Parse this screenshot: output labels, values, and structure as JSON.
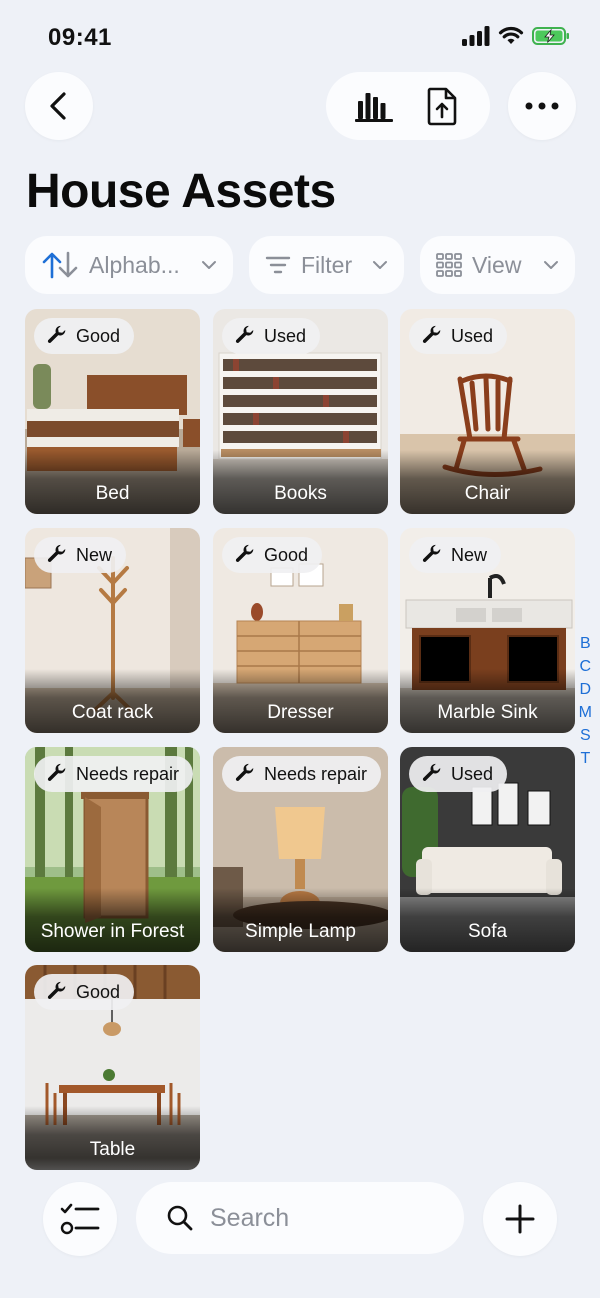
{
  "status_bar": {
    "time": "09:41"
  },
  "page": {
    "title": "House Assets"
  },
  "toolbar": {
    "sort_label": "Alphab...",
    "filter_label": "Filter",
    "view_label": "View"
  },
  "assets": [
    {
      "name": "Bed",
      "condition": "Good"
    },
    {
      "name": "Books",
      "condition": "Used"
    },
    {
      "name": "Chair",
      "condition": "Used"
    },
    {
      "name": "Coat rack",
      "condition": "New"
    },
    {
      "name": "Dresser",
      "condition": "Good"
    },
    {
      "name": "Marble Sink",
      "condition": "New"
    },
    {
      "name": "Shower in Forest",
      "condition": "Needs repair"
    },
    {
      "name": "Simple Lamp",
      "condition": "Needs repair"
    },
    {
      "name": "Sofa",
      "condition": "Used"
    },
    {
      "name": "Table",
      "condition": "Good"
    }
  ],
  "index_letters": [
    "B",
    "C",
    "D",
    "M",
    "S",
    "T"
  ],
  "search": {
    "placeholder": "Search"
  },
  "colors": {
    "accent": "#1e6fd6",
    "background": "#eef1f7",
    "surface": "#fbfcfe"
  },
  "icons": {
    "back": "chevron-left-icon",
    "chart": "bar-chart-icon",
    "export": "file-export-icon",
    "more": "more-horizontal-icon",
    "sort": "sort-arrows-icon",
    "filter": "filter-lines-icon",
    "view": "grid-view-icon",
    "condition": "wrench-icon",
    "checklist": "checklist-icon",
    "search": "search-icon",
    "add": "plus-icon"
  }
}
